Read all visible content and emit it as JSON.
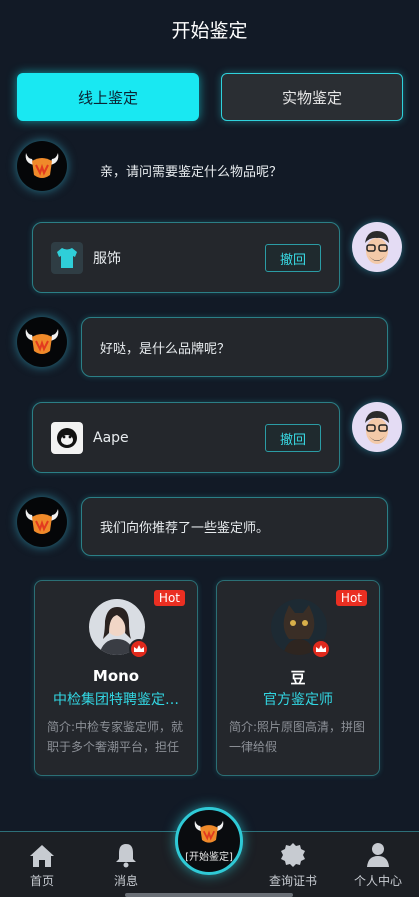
{
  "header": {
    "title": "开始鉴定"
  },
  "tabs": [
    {
      "label": "线上鉴定",
      "active": true
    },
    {
      "label": "实物鉴定",
      "active": false
    }
  ],
  "chat": {
    "bot_q1": "亲，请问需要鉴定什么物品呢？",
    "user_sel1": {
      "icon": "tshirt-icon",
      "label": "服饰",
      "withdraw": "撤回"
    },
    "bot_q2": "好哒，是什么品牌呢？",
    "user_sel2": {
      "icon": "aape-logo-icon",
      "label": "Aape",
      "withdraw": "撤回"
    },
    "bot_q3": "我们向你推荐了一些鉴定师。"
  },
  "appraisers": [
    {
      "badge": "Hot",
      "name": "Mono",
      "title": "中检集团特聘鉴定…",
      "desc": "简介:中检专家鉴定师，就职于多个奢潮平台，担任"
    },
    {
      "badge": "Hot",
      "name": "豆",
      "title": "官方鉴定师",
      "desc": "简介:照片原图高清，拼图一律给假"
    }
  ],
  "nav": {
    "home": "首页",
    "messages": "消息",
    "center": "[开始鉴定]",
    "certificate": "查询证书",
    "profile": "个人中心"
  },
  "colors": {
    "accent": "#19e8f2",
    "background": "#121a26",
    "hot": "#ea2f22"
  }
}
